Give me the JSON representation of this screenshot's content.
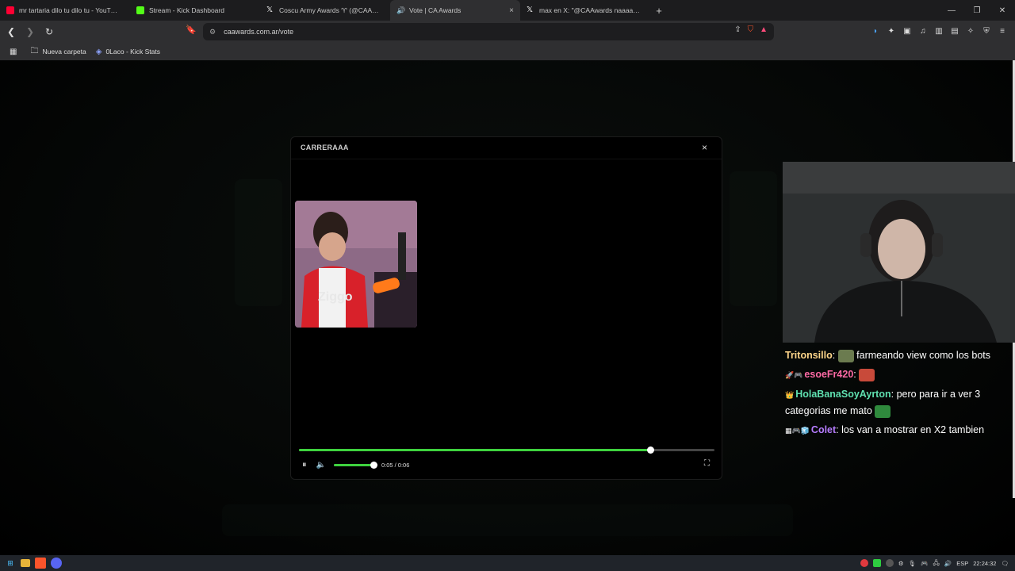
{
  "browser": {
    "tabs": [
      {
        "title": "mr tartaria dilo tu dilo tu - YouTube",
        "fav_color": "#ff0033"
      },
      {
        "title": "Stream - Kick Dashboard",
        "fav_color": "#53fc18"
      },
      {
        "title": "Coscu Army Awards ♈ (@CAAwards",
        "fav_color": "#ffffff"
      },
      {
        "title": "Vote | CA Awards",
        "fav_color": "#cccccc",
        "close": "×"
      },
      {
        "title": "max en X: \"@CAAwards naaaaa wach",
        "fav_color": "#ffffff"
      }
    ],
    "new_tab": "+",
    "url": "caawards.com.ar/vote",
    "bookmarks": [
      {
        "label": "Nueva carpeta"
      },
      {
        "label": "0Laco - Kick Stats"
      }
    ]
  },
  "modal": {
    "title": "CARRERAAA",
    "close": "×",
    "progress_fraction": 0.846,
    "volume_fraction": 1.0,
    "time": "0:05 / 0:06"
  },
  "chat": {
    "messages": [
      {
        "user": "Tritonsillo",
        "user_color": "#ffd68a",
        "badges": "",
        "text": "farmeando view como los bots",
        "emote_before": "#6b7b4f"
      },
      {
        "user": "esoeFr420",
        "user_color": "#ff6aa5",
        "badges": "🚀🎮",
        "text": "",
        "emote_after": "#c84a3a"
      },
      {
        "user": "HolaBanaSoyAyrton",
        "user_color": "#5fe0b0",
        "badges": "👑",
        "text": "pero para ir a ver 3 categorias me mato",
        "emote_after": "#2f8a3d"
      },
      {
        "user": "Colet",
        "user_color": "#b67cff",
        "badges": "▦🎮🧊",
        "text": "los van a mostrar en X2 tambien"
      }
    ]
  },
  "taskbar": {
    "lang": "ESP",
    "time": "22:24:32"
  }
}
